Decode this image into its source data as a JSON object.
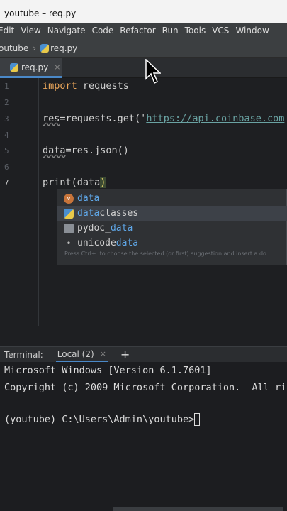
{
  "window": {
    "title": "youtube – req.py"
  },
  "menu": [
    "Edit",
    "View",
    "Navigate",
    "Code",
    "Refactor",
    "Run",
    "Tools",
    "VCS",
    "Window"
  ],
  "breadcrumb": {
    "project": "outube",
    "file": "req.py"
  },
  "editor_tab": {
    "label": "req.py",
    "close": "×"
  },
  "lines": {
    "n1": "1",
    "n2": "2",
    "n3": "3",
    "n4": "4",
    "n5": "5",
    "n6": "6",
    "n7": "7",
    "l1_kw": "import",
    "l1_rest": " requests",
    "l3_a": "res",
    "l3_b": "=requests.get('",
    "l3_url": "https://api.coinbase.com",
    "l5_a": "data",
    "l5_b": "=res.json()",
    "l7_a": "print",
    "l7_b": "(data",
    "l7_c": ")"
  },
  "autocomplete": {
    "items": [
      {
        "icon": "v",
        "prefix": "",
        "match": "data",
        "suffix": ""
      },
      {
        "icon": "",
        "prefix": "",
        "match": "data",
        "suffix": "classes"
      },
      {
        "icon": "",
        "prefix": "pydoc_",
        "match": "data",
        "suffix": ""
      },
      {
        "icon": "•",
        "prefix": "unicode",
        "match": "data",
        "suffix": ""
      }
    ],
    "hint": "Press Ctrl+. to choose the selected (or first) suggestion and insert a do"
  },
  "terminal_tabs": {
    "label": "Terminal:",
    "tab": "Local (2)",
    "close": "×",
    "add": "+"
  },
  "terminal": {
    "line1": "Microsoft Windows [Version 6.1.7601]",
    "line2": "Copyright (c) 2009 Microsoft Corporation.  All ri",
    "prompt": "(youtube) C:\\Users\\Admin\\youtube>"
  }
}
